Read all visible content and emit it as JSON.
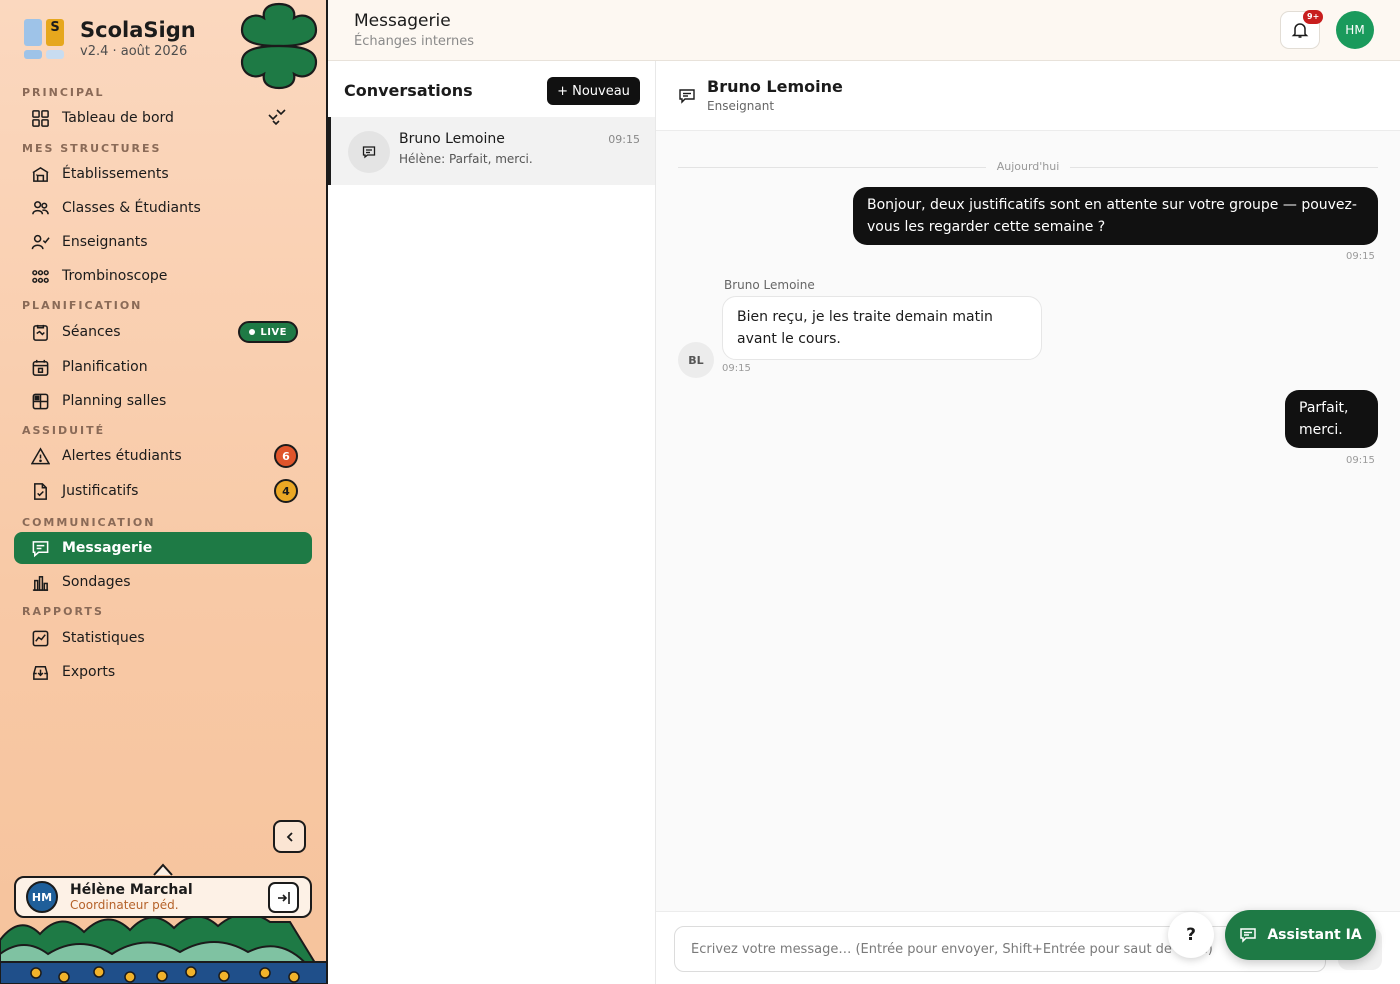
{
  "brand": {
    "logo_letter": "S",
    "name": "ScolaSign",
    "version": "v2.4 · août 2026"
  },
  "sidebar": {
    "sections": {
      "principal": "PRINCIPAL",
      "structures": "MES STRUCTURES",
      "planification": "PLANIFICATION",
      "assiduite": "ASSIDUITÉ",
      "communication": "COMMUNICATION",
      "rapports": "RAPPORTS"
    },
    "items": {
      "dashboard": "Tableau de bord",
      "etablissements": "Établissements",
      "classes": "Classes & Étudiants",
      "enseignants": "Enseignants",
      "trombinoscope": "Trombinoscope",
      "seances": "Séances",
      "planification": "Planification",
      "planning_salles": "Planning salles",
      "alertes": "Alertes étudiants",
      "justificatifs": "Justificatifs",
      "messagerie": "Messagerie",
      "sondages": "Sondages",
      "statistiques": "Statistiques",
      "exports": "Exports"
    },
    "live_label": "LIVE",
    "alertes_count": "6",
    "justificatifs_count": "4",
    "active_item": "messagerie"
  },
  "user": {
    "initials": "HM",
    "name": "Hélène Marchal",
    "role": "Coordinateur péd."
  },
  "topbar": {
    "title": "Messagerie",
    "subtitle": "Échanges internes",
    "notifications_badge": "9+",
    "avatar_initials": "HM"
  },
  "conversations": {
    "title": "Conversations",
    "new_button": "+ Nouveau",
    "items": [
      {
        "name": "Bruno Lemoine",
        "preview": "Hélène: Parfait, merci.",
        "time": "09:15"
      }
    ]
  },
  "chat": {
    "contact_name": "Bruno Lemoine",
    "contact_role": "Enseignant",
    "day_separator": "Aujourd'hui",
    "messages": [
      {
        "direction": "out",
        "text": "Bonjour, deux justificatifs sont en attente sur votre groupe — pouvez-vous les regarder cette semaine ?",
        "time": "09:15"
      },
      {
        "direction": "in",
        "sender": "Bruno Lemoine",
        "avatar": "BL",
        "text": "Bien reçu, je les traite demain matin avant le cours.",
        "time": "09:15"
      },
      {
        "direction": "out",
        "text": "Parfait, merci.",
        "time": "09:15"
      }
    ],
    "composer_placeholder": "Écrivez votre message… (Entrée pour envoyer, Shift+Entrée pour saut de ligne)"
  },
  "fabs": {
    "help": "?",
    "assistant": "Assistant IA"
  },
  "colors": {
    "accent_green": "#1e7a45",
    "sidebar_peach": "#f8c9a6",
    "alert_red": "#e0552b",
    "warning_yellow": "#eba824",
    "notification_red": "#c81e1e"
  },
  "icons": {
    "dashboard": "grid-icon",
    "etablissements": "building-icon",
    "classes": "users-icon",
    "enseignants": "user-check-icon",
    "trombinoscope": "photo-grid-icon",
    "seances": "clipboard-icon",
    "planification": "calendar-icon",
    "planning_salles": "room-grid-icon",
    "alertes": "warning-icon",
    "justificatifs": "file-check-icon",
    "messagerie": "message-icon",
    "sondages": "bar-chart-icon",
    "statistiques": "line-chart-icon",
    "exports": "export-icon"
  }
}
